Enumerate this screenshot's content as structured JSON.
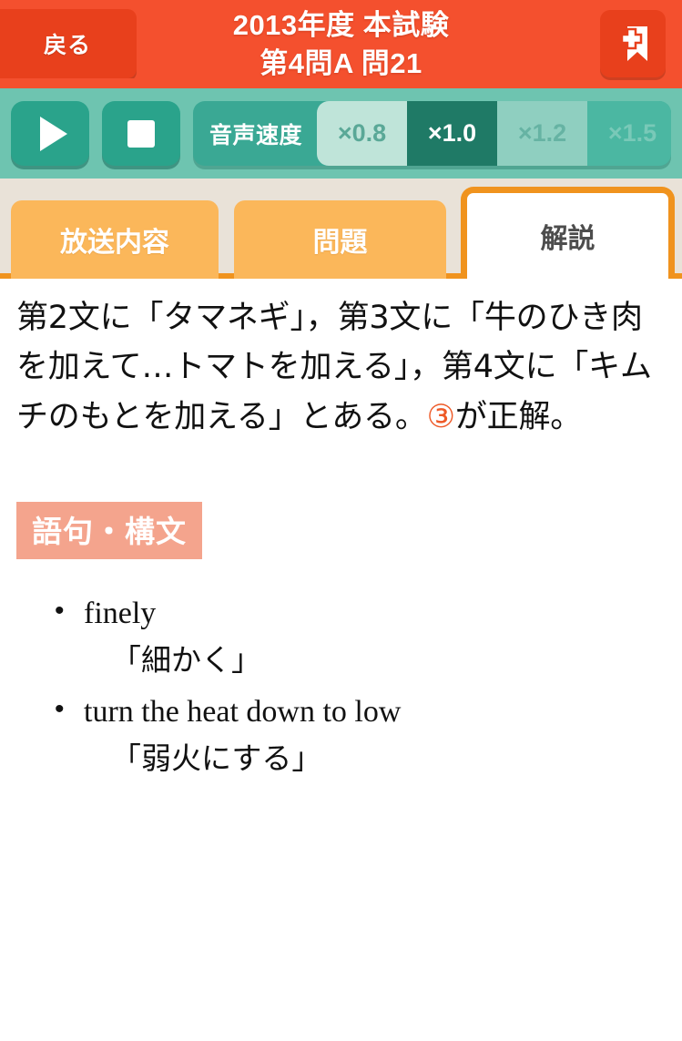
{
  "header": {
    "back_label": "戻る",
    "title_line1": "2013年度 本試験",
    "title_line2": "第4問A 問21",
    "bookmark_icon": "bookmark-plus-icon",
    "bg_color": "#f4502e",
    "button_color": "#e8401c"
  },
  "audio_toolbar": {
    "play_icon": "play-icon",
    "stop_icon": "stop-icon",
    "speed_label": "音声速度",
    "speed_options": [
      {
        "label": "×0.8",
        "selected": false
      },
      {
        "label": "×1.0",
        "selected": true
      },
      {
        "label": "×1.2",
        "selected": false
      },
      {
        "label": "×1.5",
        "selected": false
      }
    ],
    "bg_color": "#6ec4b0",
    "button_color": "#2aa38b",
    "selected_color": "#1f7a66"
  },
  "tabs": [
    {
      "label": "放送内容",
      "active": false
    },
    {
      "label": "問題",
      "active": false
    },
    {
      "label": "解説",
      "active": true
    }
  ],
  "tab_colors": {
    "inactive_bg": "#fbb75a",
    "active_border": "#f0931e",
    "bar_bg": "#e9e2d8"
  },
  "content": {
    "explanation_pre": "第2文に「タマネギ」，第3文に「牛のひき肉を加えて…トマトを加える」，第4文に「キムチのもとを加える」とある。",
    "answer_mark": "③",
    "answer_mark_color": "#ee5a28",
    "explanation_post": "が正解。",
    "section_title": "語句・構文",
    "section_badge_color": "#f4a48d",
    "vocab": [
      {
        "en": "finely",
        "ja": "「細かく」"
      },
      {
        "en": "turn the heat down to low",
        "ja": "「弱火にする」"
      }
    ]
  }
}
